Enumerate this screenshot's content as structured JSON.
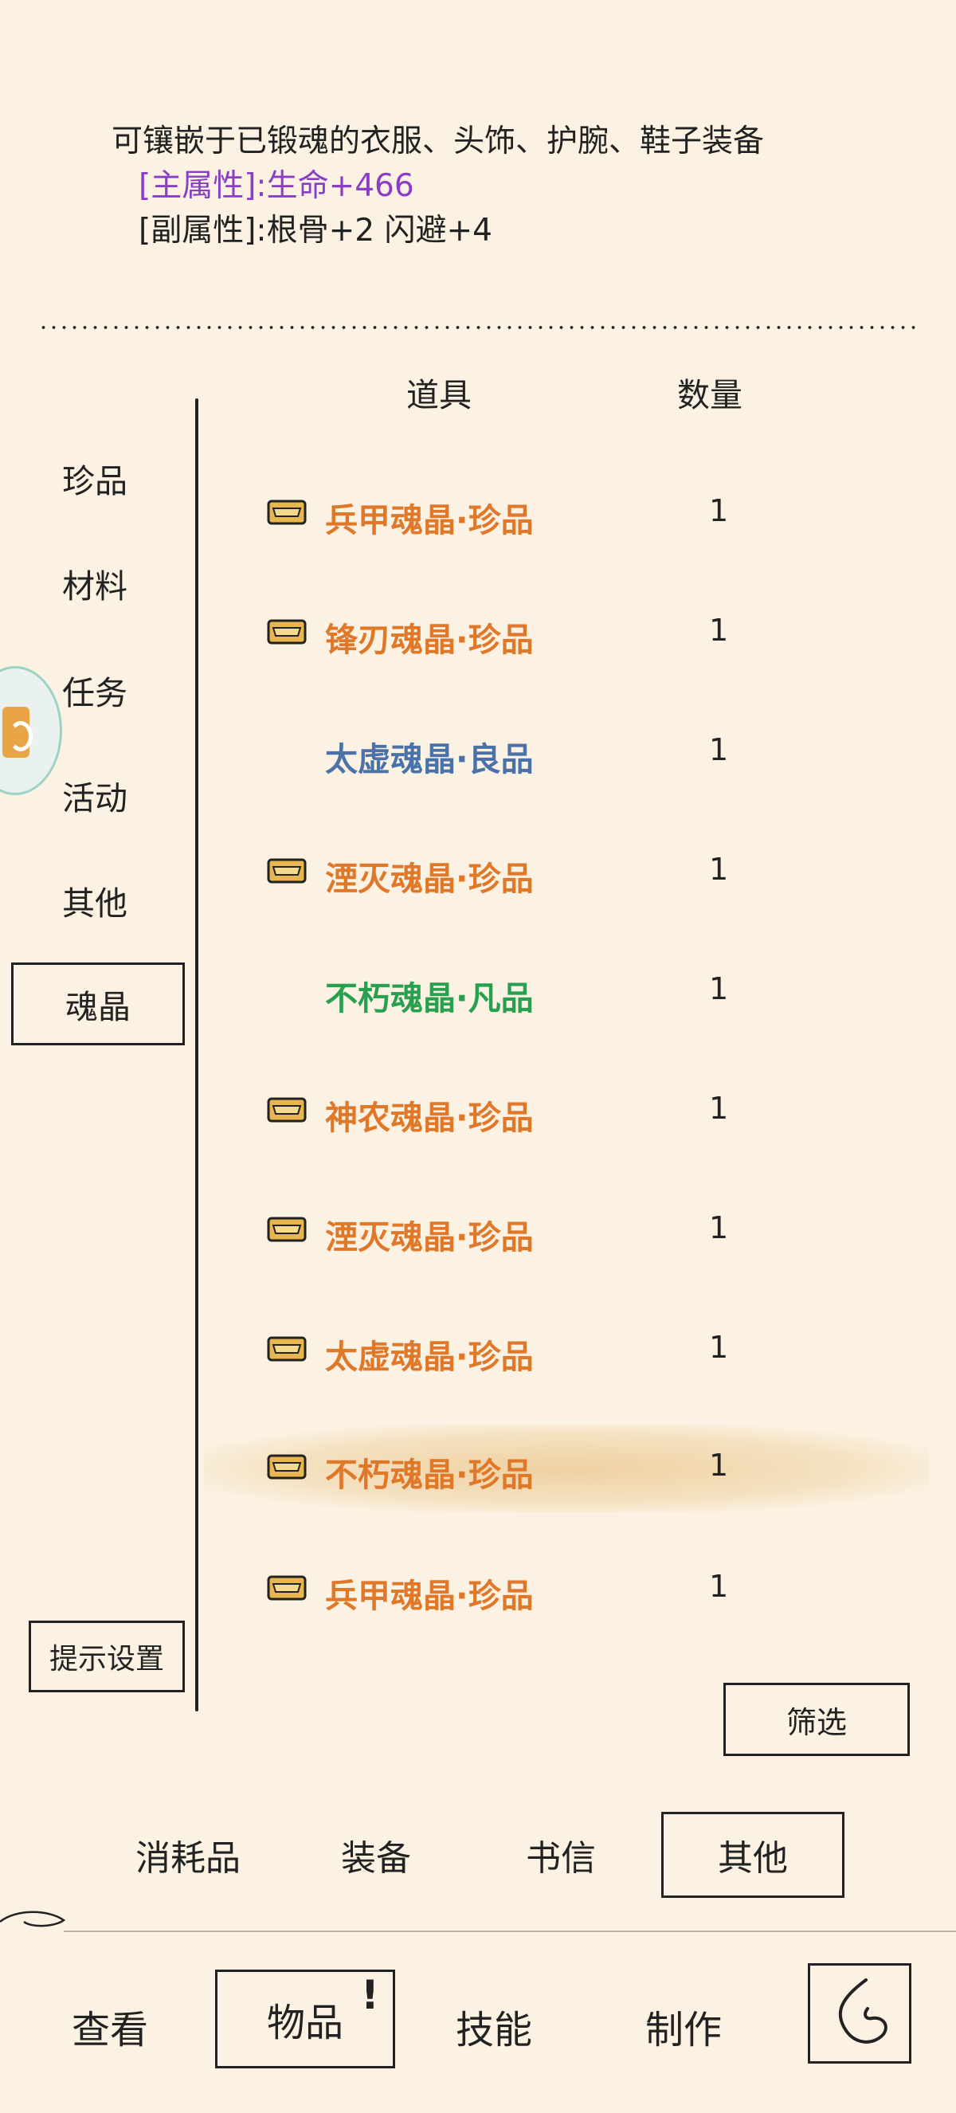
{
  "description": {
    "line1": "可镶嵌于已锻魂的衣服、头饰、护腕、鞋子装备",
    "main_attr": "[主属性]:生命+466",
    "sub_attr": "[副属性]:根骨+2 闪避+4"
  },
  "columns": {
    "item": "道具",
    "qty": "数量"
  },
  "categories": [
    "珍品",
    "材料",
    "任务",
    "活动",
    "其他",
    "魂晶"
  ],
  "selected_category": "魂晶",
  "items": [
    {
      "name": "兵甲魂晶·珍品",
      "qty": "1",
      "quality": "rare",
      "badge": true
    },
    {
      "name": "锋刃魂晶·珍品",
      "qty": "1",
      "quality": "rare",
      "badge": true
    },
    {
      "name": "太虚魂晶·良品",
      "qty": "1",
      "quality": "good",
      "badge": false
    },
    {
      "name": "湮灭魂晶·珍品",
      "qty": "1",
      "quality": "rare",
      "badge": true
    },
    {
      "name": "不朽魂晶·凡品",
      "qty": "1",
      "quality": "common",
      "badge": false
    },
    {
      "name": "神农魂晶·珍品",
      "qty": "1",
      "quality": "rare",
      "badge": true
    },
    {
      "name": "湮灭魂晶·珍品",
      "qty": "1",
      "quality": "rare",
      "badge": true
    },
    {
      "name": "太虚魂晶·珍品",
      "qty": "1",
      "quality": "rare",
      "badge": true
    },
    {
      "name": "不朽魂晶·珍品",
      "qty": "1",
      "quality": "rare",
      "badge": true,
      "selected": true
    },
    {
      "name": "兵甲魂晶·珍品",
      "qty": "1",
      "quality": "rare",
      "badge": true
    }
  ],
  "buttons": {
    "hint_settings": "提示设置",
    "filter": "筛选"
  },
  "subtabs": [
    "消耗品",
    "装备",
    "书信",
    "其他"
  ],
  "selected_subtab": "其他",
  "nav": [
    "查看",
    "物品",
    "技能",
    "制作"
  ],
  "selected_nav": "物品",
  "nav_alert": "!",
  "colors": {
    "rare": "#e0782a",
    "good": "#4a72a8",
    "common": "#28a050",
    "main_attr": "#8a3ec6",
    "background": "#fbf2e3"
  },
  "icons": {
    "item_badge": "treasure-box-icon",
    "back": "back-arrow-icon",
    "avatar": "floating-assistant-icon"
  }
}
